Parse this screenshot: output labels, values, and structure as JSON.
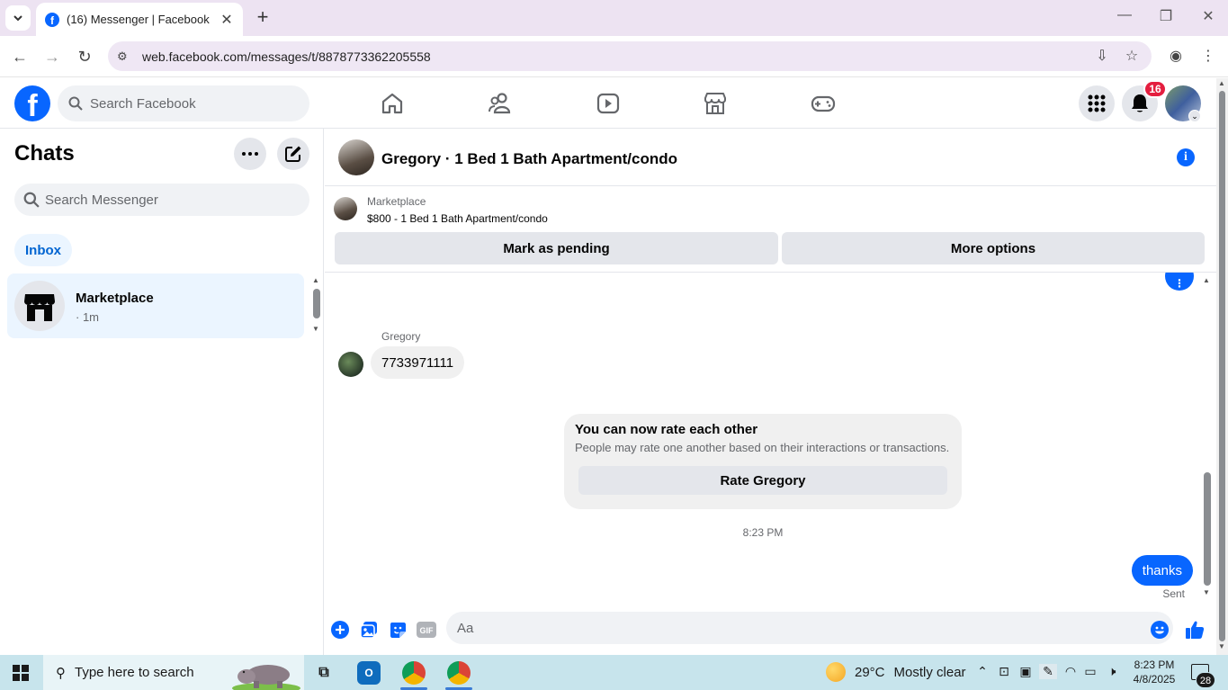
{
  "browser": {
    "tab_title": "(16) Messenger | Facebook",
    "url": "web.facebook.com/messages/t/8878773362205558"
  },
  "header": {
    "search_placeholder": "Search Facebook",
    "notification_count": "16",
    "nav_icons": [
      "home-icon",
      "friends-icon",
      "video-icon",
      "marketplace-icon",
      "gaming-icon"
    ]
  },
  "sidebar": {
    "title": "Chats",
    "search_placeholder": "Search Messenger",
    "filter_label": "Inbox",
    "chats": [
      {
        "name": "Marketplace",
        "time": "· 1m"
      }
    ]
  },
  "conversation": {
    "title": "Gregory · 1 Bed 1 Bath Apartment/condo",
    "marketplace": {
      "label": "Marketplace",
      "listing": "$800 - 1 Bed 1 Bath Apartment/condo",
      "pending_label": "Mark as pending",
      "more_label": "More options"
    },
    "messages": {
      "sender_name": "Gregory",
      "incoming_text": "7733971111",
      "rating_title": "You can now rate each other",
      "rating_subtitle": "People may rate one another based on their interactions or transactions.",
      "rating_button": "Rate Gregory",
      "timestamp": "8:23 PM",
      "outgoing_text": "thanks",
      "status": "Sent"
    },
    "composer": {
      "placeholder": "Aa",
      "gif_label": "GIF"
    }
  },
  "taskbar": {
    "search_placeholder": "Type here to search",
    "temperature": "29°C",
    "weather": "Mostly clear",
    "time": "8:23 PM",
    "date": "4/8/2025",
    "notification_count": "28"
  },
  "colors": {
    "accent": "#0866ff",
    "badge": "#e41e3f",
    "selected_chat": "#ebf5ff"
  }
}
